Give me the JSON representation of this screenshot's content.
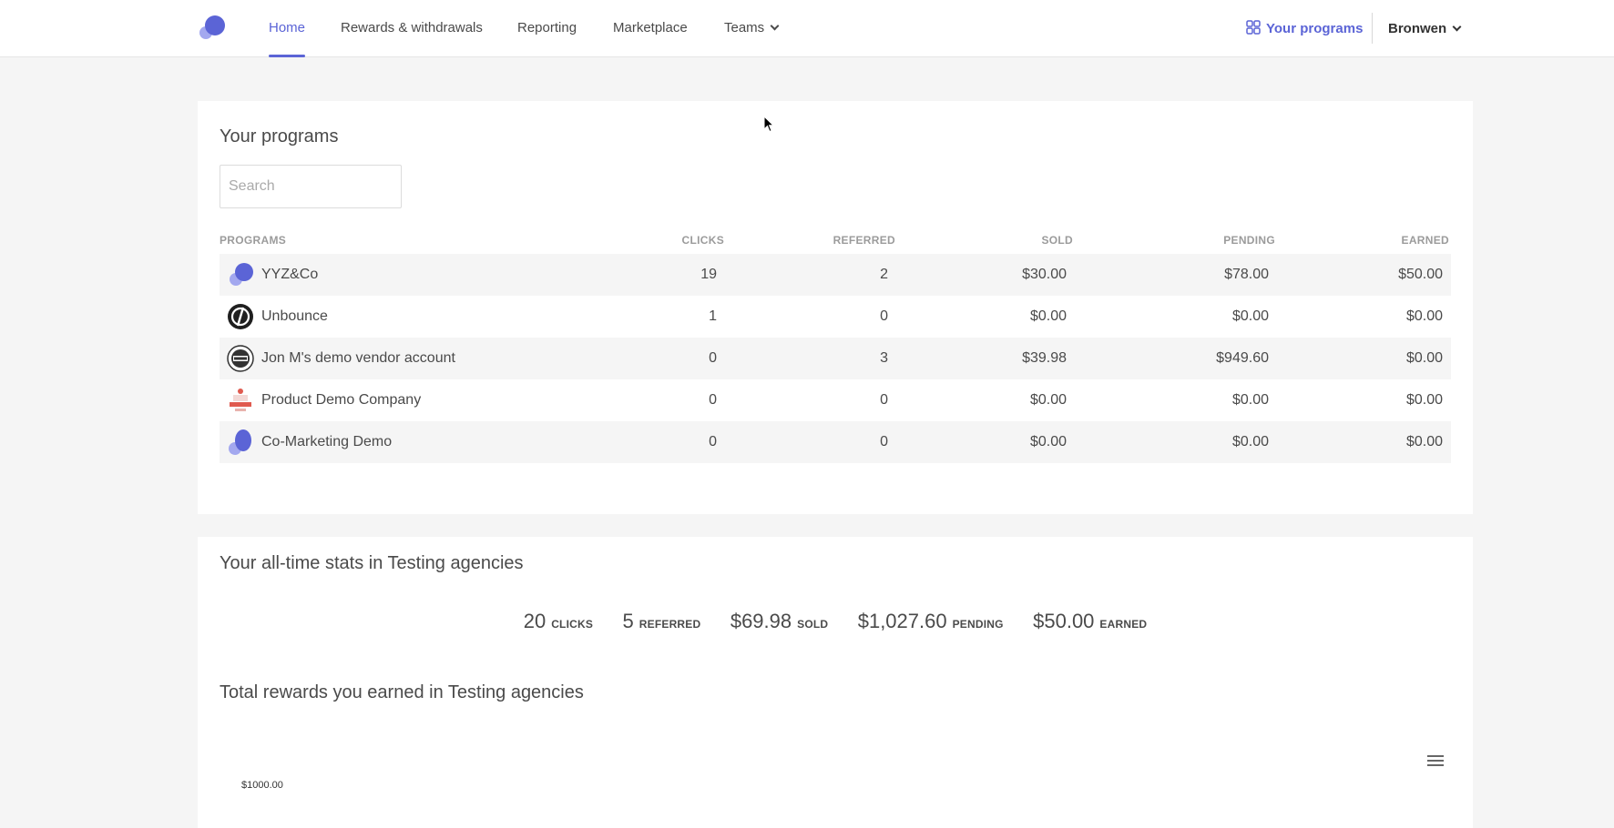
{
  "nav": {
    "items": [
      {
        "label": "Home",
        "active": true
      },
      {
        "label": "Rewards & withdrawals"
      },
      {
        "label": "Reporting"
      },
      {
        "label": "Marketplace"
      },
      {
        "label": "Teams"
      }
    ],
    "your_programs": "Your programs",
    "user": "Bronwen"
  },
  "programs_card": {
    "title": "Your programs",
    "search_placeholder": "Search",
    "columns": [
      "PROGRAMS",
      "CLICKS",
      "REFERRED",
      "SOLD",
      "PENDING",
      "EARNED"
    ],
    "rows": [
      {
        "name": "YYZ&Co",
        "clicks": "19",
        "referred": "2",
        "sold": "$30.00",
        "pending": "$78.00",
        "earned": "$50.00",
        "icon": "brand-logo-icon"
      },
      {
        "name": "Unbounce",
        "clicks": "1",
        "referred": "0",
        "sold": "$0.00",
        "pending": "$0.00",
        "earned": "$0.00",
        "icon": "unbounce-logo-icon"
      },
      {
        "name": "Jon M's demo vendor account",
        "clicks": "0",
        "referred": "3",
        "sold": "$39.98",
        "pending": "$949.60",
        "earned": "$0.00",
        "icon": "logo-badge-icon"
      },
      {
        "name": "Product Demo Company",
        "clicks": "0",
        "referred": "0",
        "sold": "$0.00",
        "pending": "$0.00",
        "earned": "$0.00",
        "icon": "award-badge-icon"
      },
      {
        "name": "Co-Marketing Demo",
        "clicks": "0",
        "referred": "0",
        "sold": "$0.00",
        "pending": "$0.00",
        "earned": "$0.00",
        "icon": "brand-logo-icon"
      }
    ]
  },
  "stats_card": {
    "title": "Your all-time stats in Testing agencies",
    "stats": [
      {
        "value": "20",
        "label": "CLICKS"
      },
      {
        "value": "5",
        "label": "REFERRED"
      },
      {
        "value": "$69.98",
        "label": "SOLD"
      },
      {
        "value": "$1,027.60",
        "label": "PENDING"
      },
      {
        "value": "$50.00",
        "label": "EARNED"
      }
    ],
    "rewards_title": "Total rewards you earned in Testing agencies",
    "y_tick": "$1000.00"
  },
  "colors": {
    "accent": "#5b64d6",
    "accent_light": "#a3a8ef"
  }
}
